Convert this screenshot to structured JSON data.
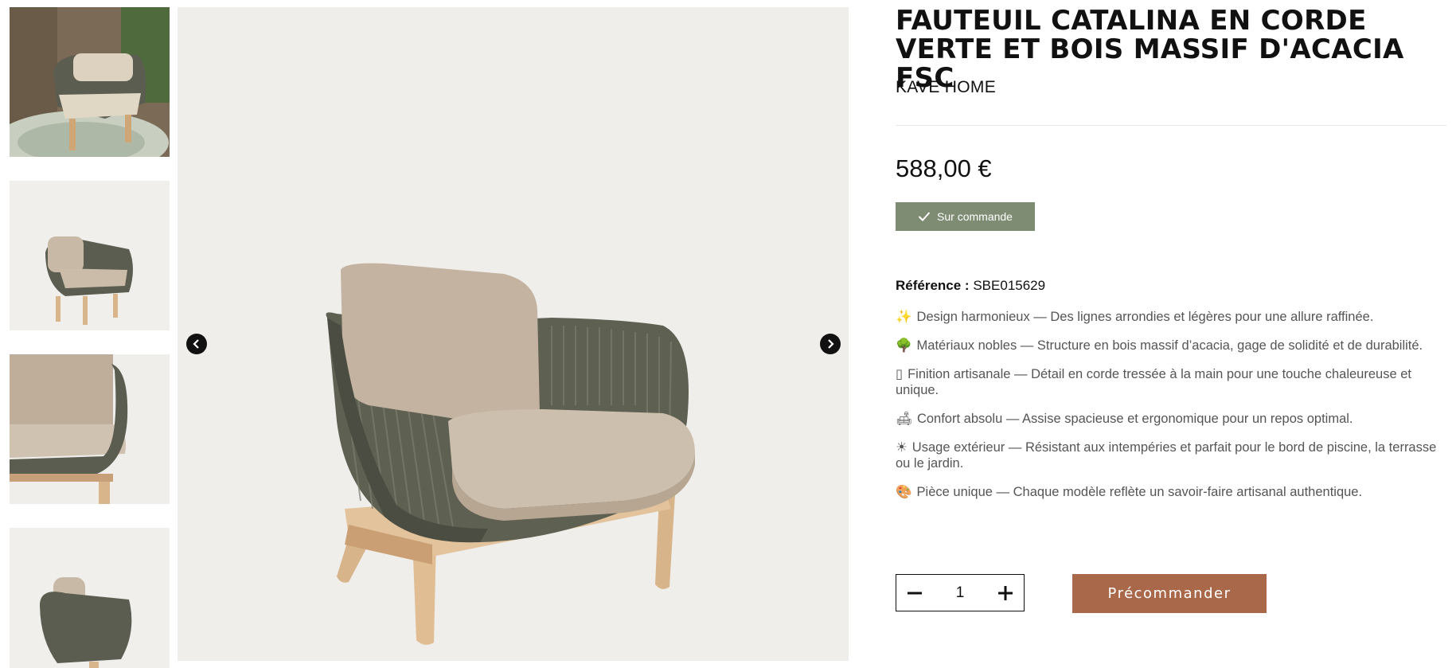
{
  "gallery": {
    "thumbnails": [
      {
        "icon": "chair-lifestyle-thumbnail"
      },
      {
        "icon": "chair-front-thumbnail"
      },
      {
        "icon": "chair-detail-thumbnail"
      },
      {
        "icon": "chair-side-thumbnail"
      }
    ],
    "prev_icon": "chevron-left-icon",
    "next_icon": "chevron-right-icon"
  },
  "product": {
    "title_line1": "FAUTEUIL CATALINA EN CORDE",
    "title_line2": "VERTE ET BOIS MASSIF D'ACACIA FSC",
    "brand": "KAVE HOME",
    "price": "588,00 €",
    "stock_label": "Sur commande",
    "reference_label": "Référence :",
    "reference_value": "SBE015629",
    "features": [
      {
        "emoji": "✨",
        "text": "Design harmonieux — Des lignes arrondies et légères pour une allure raffinée."
      },
      {
        "emoji": "🌳",
        "text": "Matériaux nobles — Structure en bois massif d’acacia, gage de solidité et de durabilité."
      },
      {
        "emoji": "▯",
        "text": "Finition artisanale — Détail en corde tressée à la main pour une touche chaleureuse et unique."
      },
      {
        "emoji": "🛋",
        "text": "Confort absolu — Assise spacieuse et ergonomique pour un repos optimal."
      },
      {
        "emoji": "☀",
        "text": "Usage extérieur — Résistant aux intempéries et parfait pour le bord de piscine, la terrasse ou le jardin."
      },
      {
        "emoji": "🎨",
        "text": "Pièce unique — Chaque modèle reflète un savoir-faire artisanal authentique."
      }
    ],
    "quantity": "1",
    "preorder_label": "Précommander"
  },
  "colors": {
    "stock_bg": "#7d8c73",
    "preorder_bg": "#a9684a",
    "rope": "#5b5d50",
    "cushion": "#c8b9a6",
    "wood": "#d9b58c"
  }
}
